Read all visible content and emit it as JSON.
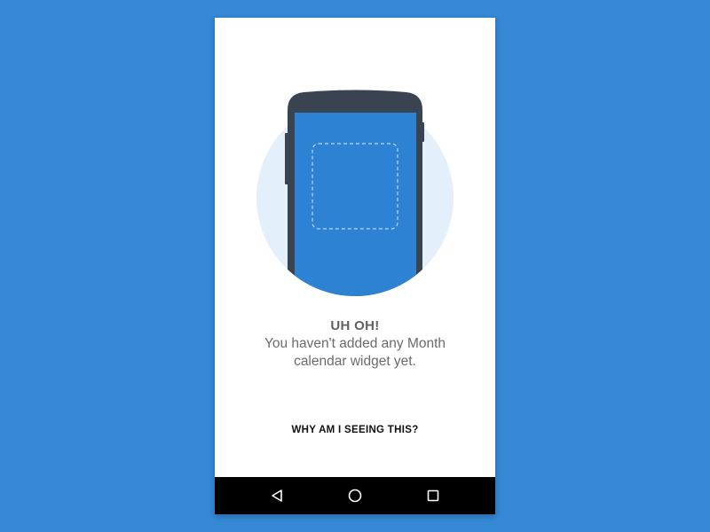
{
  "empty_state": {
    "title": "UH OH!",
    "message": "You haven't added any Month calendar widget yet.",
    "help_link": "WHY AM I SEEING THIS?"
  },
  "navigation_bar": {
    "buttons": [
      "back-icon",
      "home-icon",
      "recents-icon"
    ]
  },
  "colors": {
    "background": "#3488D4",
    "screen_blue": "#2E82D3",
    "circle": "#E3EFFB",
    "phone_body": "#3A4350"
  }
}
